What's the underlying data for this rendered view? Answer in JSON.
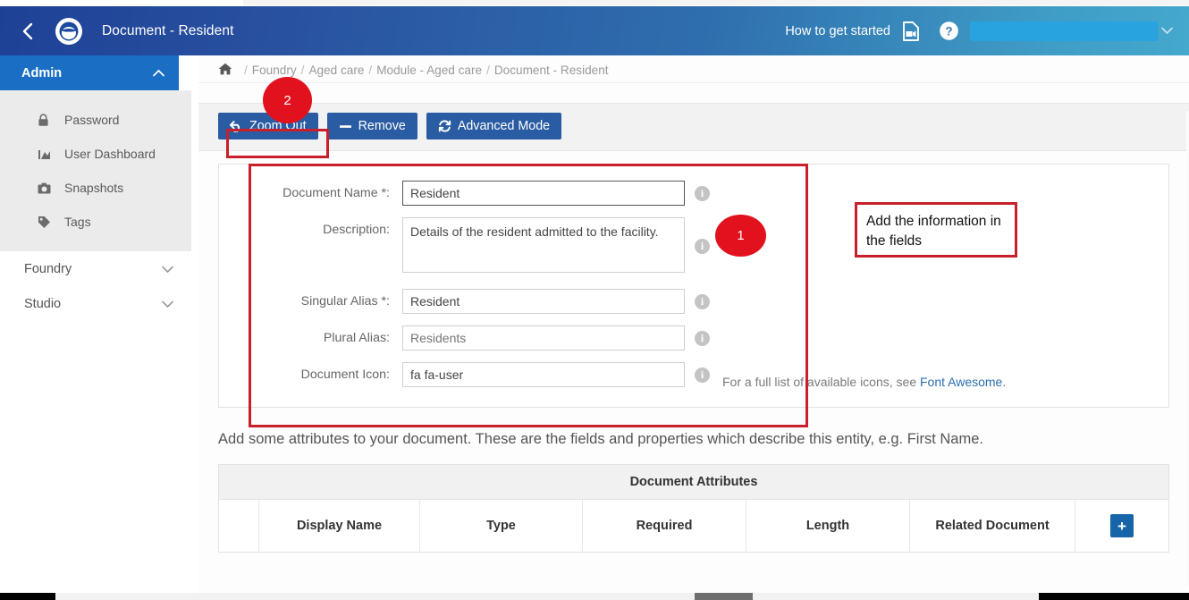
{
  "header": {
    "back_icon": "chevron-left-icon",
    "logo_icon": "app-logo-icon",
    "title": "Document - Resident",
    "get_started_label": "How to get started",
    "video_icon": "video-file-icon",
    "help_icon": "question-circle-icon",
    "redacted_user": "",
    "caret_icon": "chevron-down-icon",
    "gradient_from": "#1e4196",
    "gradient_to": "#45a8cd",
    "redaction_color": "#29a3e0"
  },
  "sidebar": {
    "group": {
      "label": "Admin",
      "expanded": true,
      "chevron": "˄"
    },
    "items": [
      {
        "label": "Password",
        "icon": "lock-icon",
        "glyph": "🔒"
      },
      {
        "label": "User Dashboard",
        "icon": "chart-area-icon",
        "glyph": "◥"
      },
      {
        "label": "Snapshots",
        "icon": "camera-icon",
        "glyph": "▣"
      },
      {
        "label": "Tags",
        "icon": "tag-icon",
        "glyph": "◢"
      }
    ],
    "collapsed": [
      {
        "label": "Foundry",
        "chevron": "˅"
      },
      {
        "label": "Studio",
        "chevron": "˅"
      }
    ]
  },
  "breadcrumb": {
    "home_icon": "home-icon",
    "items": [
      "Foundry",
      "Aged care",
      "Module - Aged care",
      "Document - Resident"
    ],
    "separator": "/"
  },
  "toolbar": {
    "buttons": [
      {
        "label": "Zoom Out",
        "icon": "undo-arrow-icon",
        "glyph": "↶"
      },
      {
        "label": "Remove",
        "icon": "minus-icon",
        "glyph": "–"
      },
      {
        "label": "Advanced Mode",
        "icon": "sync-refresh-icon",
        "glyph": "↻"
      }
    ],
    "button_color": "#2a5ca3"
  },
  "form": {
    "fields": [
      {
        "label": "Document Name *:",
        "value": "Resident",
        "placeholder": "",
        "type": "text",
        "focused": true,
        "info_icon": "info-circle-icon"
      },
      {
        "label": "Description:",
        "value": "Details of the resident admitted to the facility.",
        "placeholder": "",
        "type": "textarea",
        "focused": false,
        "info_icon": "info-circle-icon"
      },
      {
        "label": "Singular Alias *:",
        "value": "Resident",
        "placeholder": "",
        "type": "text",
        "focused": false,
        "info_icon": "info-circle-icon"
      },
      {
        "label": "Plural Alias:",
        "value": "",
        "placeholder": "Residents",
        "type": "text",
        "focused": false,
        "info_icon": "info-circle-icon"
      },
      {
        "label": "Document Icon:",
        "value": "fa fa-user",
        "placeholder": "",
        "type": "text",
        "focused": false,
        "info_icon": "info-circle-icon"
      }
    ],
    "icon_note_prefix": "For a full list of available icons, see ",
    "icon_note_link": "Font Awesome",
    "icon_note_suffix": "."
  },
  "attributes": {
    "description": "Add some attributes to your document. These are the fields and properties which describe this entity, e.g. First Name.",
    "table_title": "Document Attributes",
    "columns": [
      "Display Name",
      "Type",
      "Required",
      "Length",
      "Related Document"
    ],
    "add_button_icon": "plus-icon",
    "add_button_label": "+",
    "rows": []
  },
  "annotations": {
    "circle_one": "1",
    "circle_two": "2",
    "callout_text": "Add the information in the fields",
    "accent_color": "#c8202a",
    "circle_color": "#e1121d"
  }
}
